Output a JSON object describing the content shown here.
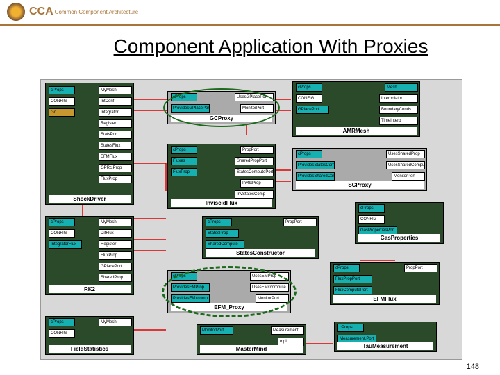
{
  "header": {
    "logo_text": "CCA",
    "subtitle": "Common Component Architecture"
  },
  "title": "Component Application With Proxies",
  "page_number": "148",
  "components": {
    "shock_driver": {
      "title": "ShockDriver",
      "ports": [
        "cProps",
        "CONFIG",
        "Go",
        "MyMesh",
        "IntConf",
        "Integrator",
        "Register",
        "StatsPort",
        "StatesFlux",
        "EFMFlux",
        "GPRc.Prop",
        "FluxProp"
      ]
    },
    "gcproxy": {
      "title": "GCProxy",
      "ports": [
        "cProps",
        "ProvidesGPlacePort",
        "UsesGPlacePort",
        "MonitorPort"
      ]
    },
    "amrmesh": {
      "title": "AMRMesh",
      "ports": [
        "cProps",
        "CONFIG",
        "GPlacePort",
        "Mesh",
        "Interpolator",
        "BoundaryConds",
        "TimeInterp"
      ]
    },
    "inviscid": {
      "title": "InviscidFlux",
      "ports": [
        "cProps",
        "Fluxes",
        "FluxProp",
        "PropPort",
        "SharedPropPort",
        "StatesComputePort",
        "InvflxProp",
        "InvStatesComp"
      ]
    },
    "scproxy": {
      "title": "SCProxy",
      "ports": [
        "cProps",
        "ProvidesStatesCompute",
        "ProvidesSharedCompute",
        "UsesSharedProp",
        "UsesSharedCompute",
        "MonitorPort"
      ]
    },
    "rk2": {
      "title": "RK2",
      "ports": [
        "cProps",
        "CONFIG",
        "IntegratorFlux",
        "MyMesh",
        "DifFlux",
        "Register",
        "FluxProp",
        "GPlacePort",
        "SharedProp"
      ]
    },
    "statesconstructor": {
      "title": "StatesConstructor",
      "ports": [
        "cProps",
        "StatesProp",
        "SharedCompute",
        "PropPort"
      ]
    },
    "gasproperties": {
      "title": "GasProperties",
      "ports": [
        "cProps",
        "CONFIG",
        "GasPropertiesPort"
      ]
    },
    "efmproxy": {
      "title": "EFM_Proxy",
      "ports": [
        "cProps",
        "ProvidesEMProp",
        "ProvidesEMxcompute",
        "UsesEMProp",
        "UsesEMxcompute",
        "MonitorPort"
      ]
    },
    "efmflux": {
      "title": "EFMFlux",
      "ports": [
        "cProps",
        "FluxPropPort",
        "FluxComputePort",
        "PropPort"
      ]
    },
    "fieldstatistics": {
      "title": "FieldStatistics",
      "ports": [
        "cProps",
        "CONFIG",
        "MyMesh"
      ]
    },
    "mastermind": {
      "title": "MasterMind",
      "ports": [
        "MonitorPort",
        "Measurement",
        "mpi"
      ]
    },
    "taumeasurement": {
      "title": "TauMeasurement",
      "ports": [
        "cProps",
        "Measurement.Port"
      ]
    }
  }
}
